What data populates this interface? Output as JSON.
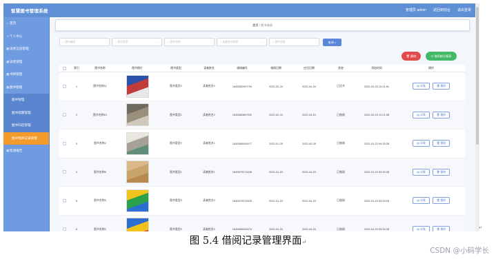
{
  "app": {
    "title": "智慧图书管理系统"
  },
  "topnav": [
    {
      "label": "管理员 admin"
    },
    {
      "label": "返回到前台"
    },
    {
      "label": "退出登录"
    }
  ],
  "sidebar": {
    "items": [
      {
        "label": "首页",
        "icon": "home-icon",
        "type": "item"
      },
      {
        "label": "个人中心",
        "icon": "user-icon",
        "type": "item"
      },
      {
        "label": "读者信息管理",
        "icon": "grid-icon",
        "type": "item"
      },
      {
        "label": "读者管理",
        "icon": "grid-icon",
        "type": "item"
      },
      {
        "label": "书目管理",
        "icon": "grid-icon",
        "type": "item"
      },
      {
        "label": "图书管理",
        "icon": "grid-icon",
        "type": "item"
      },
      {
        "label": "图书管理",
        "icon": "",
        "type": "sub"
      },
      {
        "label": "图书延期管理",
        "icon": "",
        "type": "sub"
      },
      {
        "label": "图书归还管理",
        "icon": "",
        "type": "sub"
      },
      {
        "label": "图书借阅记录管理",
        "icon": "",
        "type": "active"
      },
      {
        "label": "检测报告",
        "icon": "grid-icon",
        "type": "item"
      }
    ]
  },
  "breadcrumb": {
    "home": "首页",
    "sep": "/",
    "current": "图书借阅"
  },
  "filters": [
    {
      "placeholder": "图书编号",
      "icon": "search-icon",
      "dropdown": false
    },
    {
      "placeholder": "图书类型",
      "icon": "search-icon",
      "dropdown": true
    },
    {
      "placeholder": "图书名称",
      "icon": "search-icon",
      "dropdown": false
    },
    {
      "placeholder": "读者借书权限",
      "icon": "search-icon",
      "dropdown": true
    },
    {
      "placeholder": "借书状态",
      "icon": "search-icon",
      "dropdown": false
    }
  ],
  "search_button": {
    "label": "查询 ⌕"
  },
  "actions": {
    "delete_label": "🗑 删除",
    "export_label": "◷ 借阅统计报表"
  },
  "table": {
    "columns": [
      "",
      "索引",
      "图书名称",
      "图书图片",
      "图书类型",
      "读者姓名",
      "借阅编号",
      "借阅日期",
      "应归日期",
      "状态",
      "添加时间",
      "操作"
    ],
    "rows": [
      {
        "index": "1",
        "name": "图书名称11",
        "type": "图书类型2",
        "reader": "读者姓名2",
        "borrow_no": "1645582907794",
        "borrow_date": "2022-02-24",
        "due_date": "2022-04-24",
        "status": "已还书",
        "added": "2022-02-23 10:21:51",
        "cover": [
          "#2a52a8",
          "#c23a3a",
          "#e8e8e8"
        ]
      },
      {
        "index": "2",
        "name": "图书名称10",
        "type": "图书类型1",
        "reader": "读者姓名2",
        "borrow_no": "1645582867922",
        "borrow_date": "2022-02-24",
        "due_date": "2022-03-24",
        "status": "已借阅",
        "added": "2022-02-23 10:21:08",
        "cover": [
          "#6b6b60",
          "#9a8f7a",
          "#cfc9bb"
        ]
      },
      {
        "index": "3",
        "name": "图书名称2",
        "type": "图书类型2",
        "reader": "读者姓名1",
        "borrow_no": "1645580004577",
        "borrow_date": "2022-01-25",
        "due_date": "2022-03-25",
        "status": "已借阅",
        "added": "2022-01-23 09:33:28",
        "cover": [
          "#e8e6df",
          "#a7a296",
          "#5f8f7a"
        ]
      },
      {
        "index": "4",
        "name": "图书名称6",
        "type": "图书类型1",
        "reader": "读者姓名1",
        "borrow_no": "1645579371626",
        "borrow_date": "2022-01-23",
        "due_date": "2022-04-23",
        "status": "已借阅",
        "added": "2022-01-23 09:33:28",
        "cover": [
          "#d9b98a",
          "#c9a46a",
          "#b88a4e"
        ]
      },
      {
        "index": "5",
        "name": "图书名称5",
        "type": "图书类型3",
        "reader": "读者姓名3",
        "borrow_no": "1645579371625",
        "borrow_date": "2022-01-23",
        "due_date": "2022-04-23",
        "status": "已借阅",
        "added": "2022-01-23 09:33:28",
        "cover": [
          "#f0c21b",
          "#2aa14a",
          "#2d6fd1"
        ]
      },
      {
        "index": "6",
        "name": "图书名称2",
        "type": "图书类型2",
        "reader": "读者姓名2",
        "borrow_no": "1645580004574",
        "borrow_date": "2022-01-23",
        "due_date": "2022-04-23",
        "status": "已借阅",
        "added": "2022-01-23 09:33:28",
        "cover": [
          "#2d6fd1",
          "#f0c21b",
          "#e04a4a"
        ]
      }
    ],
    "detail_label": "▤ 详情",
    "delete_label": "🗑 删除"
  },
  "caption": {
    "text": "图 5.4 借阅记录管理界面",
    "mark": "↵"
  },
  "watermark": "CSDN @小码学长",
  "colors": {
    "topbar": "#5f8fd4",
    "sidebar": "#6f9be0",
    "active": "#f29a2a",
    "primary": "#5b86d9",
    "danger": "#e24b4b",
    "success": "#43b867"
  }
}
